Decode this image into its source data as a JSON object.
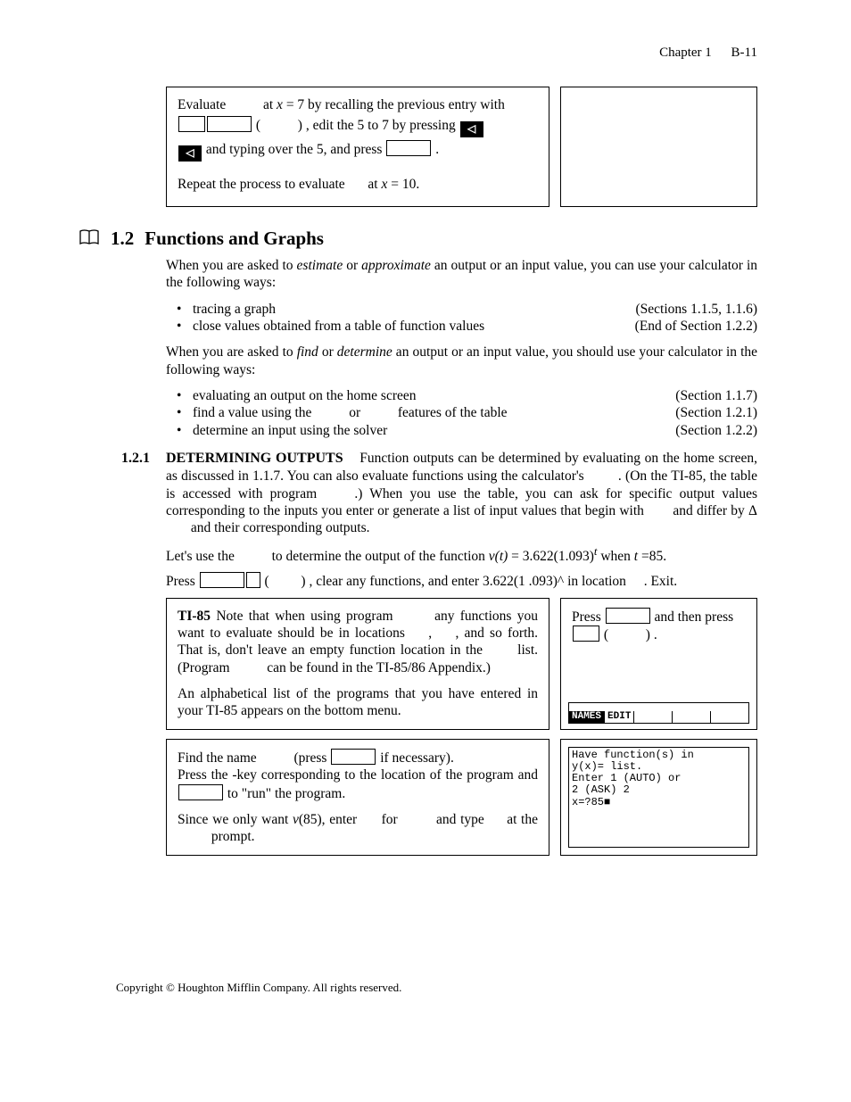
{
  "header": {
    "chapter": "Chapter 1",
    "page": "B-11"
  },
  "box1": {
    "line1a": "Evaluate ",
    "line1b": " at ",
    "line1c": "x",
    "line1d": " = 7 by recalling the previous entry with",
    "line2a": " ( ",
    "line2b": " ) , edit the 5 to 7 by pressing ",
    "line3a": " and typing over the 5, and press ",
    "line3b": " .",
    "line4a": "Repeat the process to evaluate ",
    "line4b": " at ",
    "line4c": "x",
    "line4d": " = 10."
  },
  "section": {
    "num": "1.2",
    "title": "Functions and Graphs",
    "intro1a": "When you are asked to ",
    "intro1b": "estimate",
    "intro1c": " or ",
    "intro1d": "approximate",
    "intro1e": "  an output or an input value, you can use your calculator in the following ways:",
    "bul1a": "tracing a graph",
    "ref1a": "(Sections 1.1.5, 1.1.6)",
    "bul1b": "close values obtained from a table of function values",
    "ref1b": "(End of Section 1.2.2)",
    "intro2a": "When you are asked to ",
    "intro2b": "find",
    "intro2c": " or ",
    "intro2d": "determine",
    "intro2e": "  an output or an input value, you should use your calculator in the following ways:",
    "bul2a": "evaluating an output on the home screen",
    "ref2a": "(Section 1.1.7)",
    "bul2b_a": "find a value using the ",
    "bul2b_b": " or ",
    "bul2b_c": " features of the table",
    "ref2b": "(Section 1.2.1)",
    "bul2c": "determine an input using the solver",
    "ref2c": "(Section 1.2.2)"
  },
  "sub": {
    "num": "1.2.1",
    "title": "DETERMINING OUTPUTS",
    "p1": "Function outputs can be determined by evaluating on the home screen, as discussed in 1.1.7.  You can also evaluate functions using the calculator's ",
    "p1b": ".  (On the TI-85, the table is accessed with program ",
    "p1c": ".)  When you use the table, you can ask for specific output values corresponding to the inputs you enter or generate a list of input values that begin with ",
    "p1d": " and differ by Δ",
    "p1e": " and their corresponding outputs.",
    "p2a": "Let's use the ",
    "p2b": " to determine the output of the function ",
    "p2c": "v(t)",
    "p2d": " = 3.622(1.093)",
    "p2e": "t",
    "p2f": " when ",
    "p2g": "t ",
    "p2h": "=85.",
    "p3a": "Press ",
    "p3b": " ( ",
    "p3c": " ) , clear any functions, and enter  3.622(1 .093)^     in location ",
    "p3d": " . Exit."
  },
  "table2": {
    "left_title": "TI-85",
    "l1": "   Note that when using program ",
    "l2": " any functions you want to evaluate should be in locations ",
    "l3": " , ",
    "l4": " , and so forth.  That is, don't leave an empty function location in the ",
    "l5": " list.  (Program ",
    "l6": " can be found in the TI-85/86 Appendix.)",
    "l7": "An alphabetical list of the programs that you have entered in your TI-85 appears on the bottom menu.",
    "r1a": "Press ",
    "r1b": " and then press",
    "r2a": " ( ",
    "r2b": " ) .",
    "menu1": "NAMES",
    "menu2": "EDIT"
  },
  "row3": {
    "l1a": "Find the name ",
    "l1b": " (press ",
    "l1c": " if necessary).",
    "l2a": "Press the   -key corresponding to the location of the program and ",
    "l2b": " to \"run\" the program.",
    "l3a": "Since we only want ",
    "l3b": "v",
    "l3c": "(85), enter ",
    "l3d": " for ",
    "l3e": " and type ",
    "l3f": " at the ",
    "l3g": " prompt.",
    "screen": "Have function(s) in\ny(x)= list.\nEnter 1 (AUTO) or\n2 (ASK) 2\nx=?85■"
  },
  "footer": "Copyright © Houghton Mifflin Company.  All rights reserved."
}
